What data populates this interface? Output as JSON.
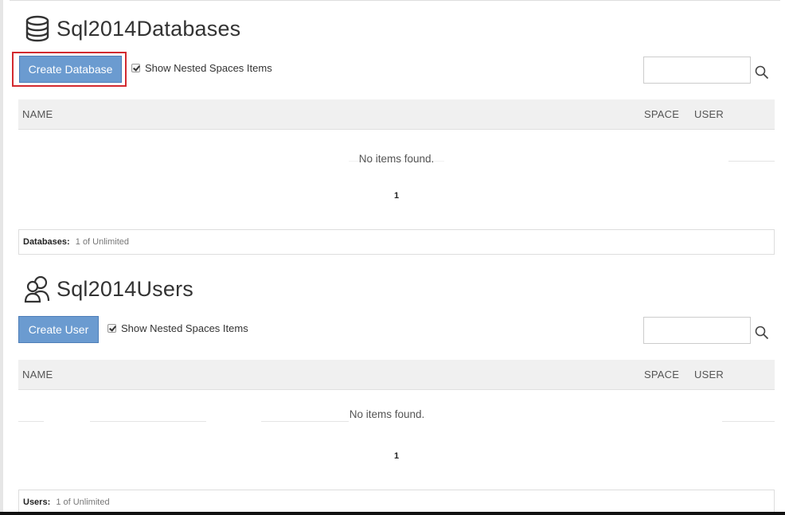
{
  "databases": {
    "title": "Sql2014Databases",
    "icon": "database-icon",
    "create_label": "Create Database",
    "nested_label": "Show Nested Spaces Items",
    "nested_checked": true,
    "search_placeholder": "",
    "search_value": "",
    "columns": [
      "NAME",
      "SPACE",
      "USER"
    ],
    "empty_text": "No items found.",
    "page_number": "1",
    "quota_label": "Databases:",
    "quota_value": "1 of Unlimited"
  },
  "users": {
    "title": "Sql2014Users",
    "icon": "users-icon",
    "create_label": "Create User",
    "nested_label": "Show Nested Spaces Items",
    "nested_checked": true,
    "search_placeholder": "",
    "search_value": "",
    "columns": [
      "NAME",
      "SPACE",
      "USER"
    ],
    "empty_text": "No items found.",
    "page_number": "1",
    "quota_label": "Users:",
    "quota_value": "1 of Unlimited"
  },
  "colors": {
    "button": "#6b9bd0",
    "highlight": "#d22a2f",
    "header_bg": "#f0f0f0"
  }
}
